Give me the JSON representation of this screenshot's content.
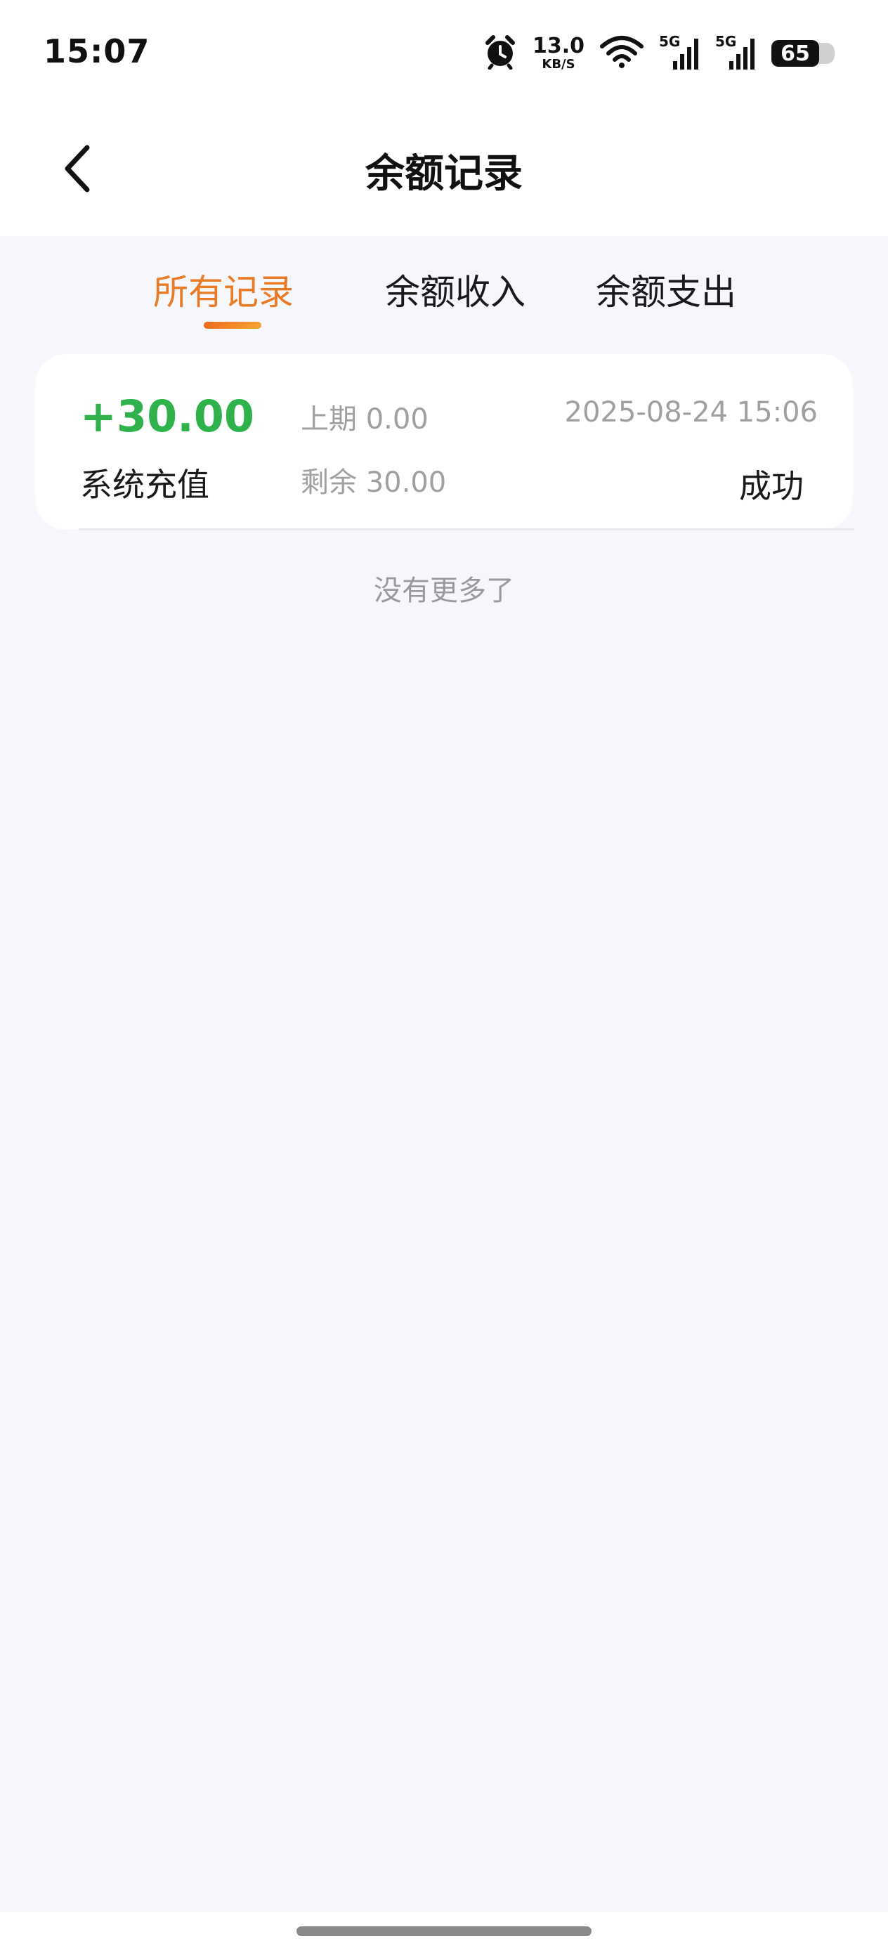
{
  "status_bar": {
    "time": "15:07",
    "net_speed_value": "13.0",
    "net_speed_unit": "KB/S",
    "signal_1_label": "5G",
    "signal_2_label": "5G",
    "battery_level": "65",
    "icons": [
      "alarm-icon",
      "wifi-icon",
      "signal-icon",
      "signal-icon",
      "battery-icon"
    ]
  },
  "header": {
    "title": "余额记录",
    "back_icon": "chevron-left-icon"
  },
  "tabs": [
    {
      "label": "所有记录",
      "active": true
    },
    {
      "label": "余额收入",
      "active": false
    },
    {
      "label": "余额支出",
      "active": false
    }
  ],
  "records": [
    {
      "amount": "+30.00",
      "type": "系统充值",
      "previous": "上期 0.00",
      "remaining": "剩余 30.00",
      "time": "2025-08-24 15:06",
      "status": "成功"
    }
  ],
  "list_footer": "没有更多了",
  "colors": {
    "accent": "#ea7b27",
    "income": "#2fb24c",
    "muted": "#a0a0a0",
    "background": "#f5f7fc"
  }
}
